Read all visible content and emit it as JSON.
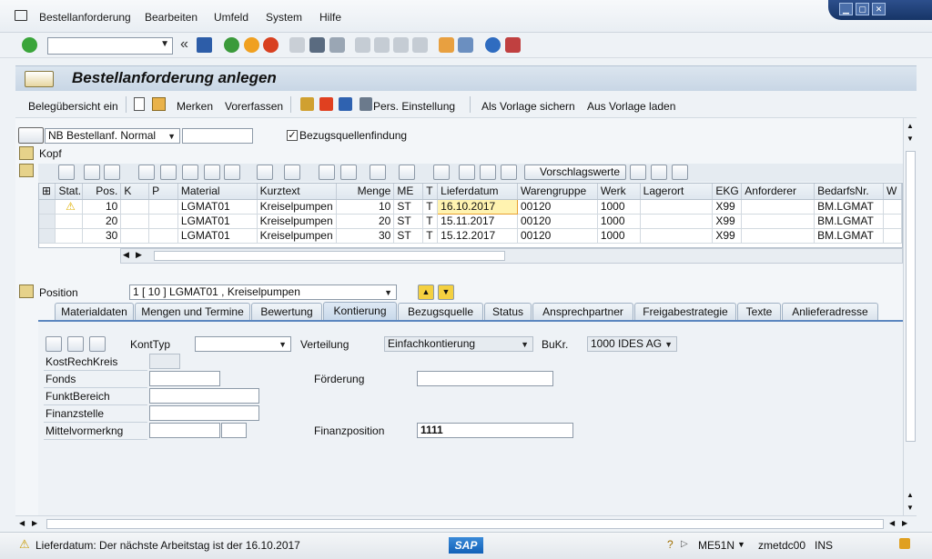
{
  "menu": {
    "items": [
      "Bestellanforderung",
      "Bearbeiten",
      "Umfeld",
      "System",
      "Hilfe"
    ],
    "underline": [
      "B",
      "B",
      "U",
      "S",
      "H"
    ]
  },
  "window_controls": [
    "▁",
    "▢",
    "✕"
  ],
  "toolbar": {
    "command_value": "",
    "back_symbol": "«"
  },
  "title": "Bestellanforderung anlegen",
  "app_toolbar": {
    "beleg": "Belegübersicht ein",
    "merken": "Merken",
    "vorerfassen": "Vorerfassen",
    "pers": "Pers. Einstellung",
    "vorlage_sichern": "Als Vorlage sichern",
    "vorlage_laden": "Aus Vorlage laden"
  },
  "header": {
    "doc_type": "NB Bestellanf. Normal",
    "doc_number": "",
    "bezugsquellen_label": "Bezugsquellenfindung",
    "bezugsquellen_checked": "✓",
    "kopf_label": "Kopf"
  },
  "grid_toolbar": {
    "vorschlagswerte": "Vorschlagswerte"
  },
  "grid": {
    "columns": [
      "Stat.",
      "Pos.",
      "K",
      "P",
      "Material",
      "Kurztext",
      "Menge",
      "ME",
      "T",
      "Lieferdatum",
      "Warengruppe",
      "Werk",
      "Lagerort",
      "EKG",
      "Anforderer",
      "BedarfsNr.",
      "W"
    ],
    "rows": [
      {
        "stat": "⚠",
        "pos": "10",
        "k": "",
        "p": "",
        "material": "LGMAT01",
        "kurztext": "Kreiselpumpen",
        "menge": "10",
        "me": "ST",
        "t": "T",
        "lieferdatum": "16.10.2017",
        "warengruppe": "00120",
        "werk": "1000",
        "lagerort": "",
        "ekg": "X99",
        "anforderer": "",
        "bedarfsnr": "BM.LGMAT"
      },
      {
        "stat": "",
        "pos": "20",
        "k": "",
        "p": "",
        "material": "LGMAT01",
        "kurztext": "Kreiselpumpen",
        "menge": "20",
        "me": "ST",
        "t": "T",
        "lieferdatum": "15.11.2017",
        "warengruppe": "00120",
        "werk": "1000",
        "lagerort": "",
        "ekg": "X99",
        "anforderer": "",
        "bedarfsnr": "BM.LGMAT"
      },
      {
        "stat": "",
        "pos": "30",
        "k": "",
        "p": "",
        "material": "LGMAT01",
        "kurztext": "Kreiselpumpen",
        "menge": "30",
        "me": "ST",
        "t": "T",
        "lieferdatum": "15.12.2017",
        "warengruppe": "00120",
        "werk": "1000",
        "lagerort": "",
        "ekg": "X99",
        "anforderer": "",
        "bedarfsnr": "BM.LGMAT"
      }
    ]
  },
  "position": {
    "label": "Position",
    "value": "1 [ 10 ] LGMAT01 , Kreiselpumpen"
  },
  "tabs": [
    "Materialdaten",
    "Mengen und Termine",
    "Bewertung",
    "Kontierung",
    "Bezugsquelle",
    "Status",
    "Ansprechpartner",
    "Freigabestrategie",
    "Texte",
    "Anlieferadresse"
  ],
  "active_tab": "Kontierung",
  "kontierung": {
    "konttyp_label": "KontTyp",
    "konttyp_value": "",
    "verteilung_label": "Verteilung",
    "verteilung_value": "Einfachkontierung",
    "bukr_label": "BuKr.",
    "bukr_value": "1000 IDES AG",
    "kostrechkreis_label": "KostRechKreis",
    "fonds_label": "Fonds",
    "foerderung_label": "Förderung",
    "funktbereich_label": "FunktBereich",
    "finanzstelle_label": "Finanzstelle",
    "mittelvormerkung_label": "Mittelvormerkng",
    "finanzposition_label": "Finanzposition",
    "finanzposition_value": "1111"
  },
  "status": {
    "message": "Lieferdatum: Der nächste Arbeitstag ist der 16.10.2017",
    "sap_logo": "SAP",
    "transaction": "ME51N",
    "server": "zmetdc00",
    "mode": "INS"
  },
  "colors": {
    "accent": "#5b86bf",
    "title_bg": "#c8d6e5",
    "highlight": "#fff3b0",
    "warning": "#f2c200"
  }
}
